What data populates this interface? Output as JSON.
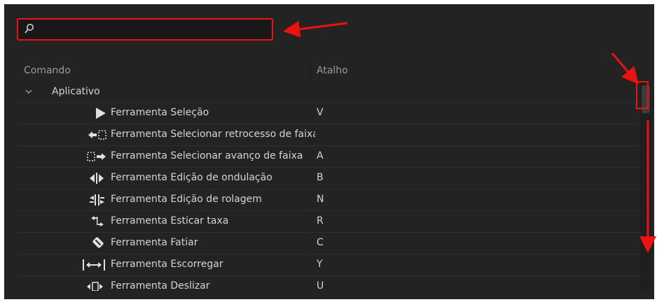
{
  "search": {
    "value": "",
    "placeholder": ""
  },
  "header": {
    "command": "Comando",
    "shortcut": "Atalho"
  },
  "group": {
    "label": "Aplicativo"
  },
  "rows": [
    {
      "icon": "selection-tool-icon",
      "command": "Ferramenta Seleção",
      "key": "V"
    },
    {
      "icon": "track-select-backward-icon",
      "command": "Ferramenta Selecionar retrocesso de faixa",
      "key": ""
    },
    {
      "icon": "track-select-forward-icon",
      "command": "Ferramenta Selecionar avanço de faixa",
      "key": "A"
    },
    {
      "icon": "ripple-edit-icon",
      "command": "Ferramenta Edição de ondulação",
      "key": "B"
    },
    {
      "icon": "rolling-edit-icon",
      "command": "Ferramenta Edição de rolagem",
      "key": "N"
    },
    {
      "icon": "rate-stretch-icon",
      "command": "Ferramenta Esticar taxa",
      "key": "R"
    },
    {
      "icon": "razor-icon",
      "command": "Ferramenta Fatiar",
      "key": "C"
    },
    {
      "icon": "slip-icon",
      "command": "Ferramenta Escorregar",
      "key": "Y"
    },
    {
      "icon": "slide-icon",
      "command": "Ferramenta Deslizar",
      "key": "U"
    }
  ],
  "colors": {
    "panel": "#232323",
    "annotation": "#ee1111",
    "text": "#d4d4d4"
  }
}
